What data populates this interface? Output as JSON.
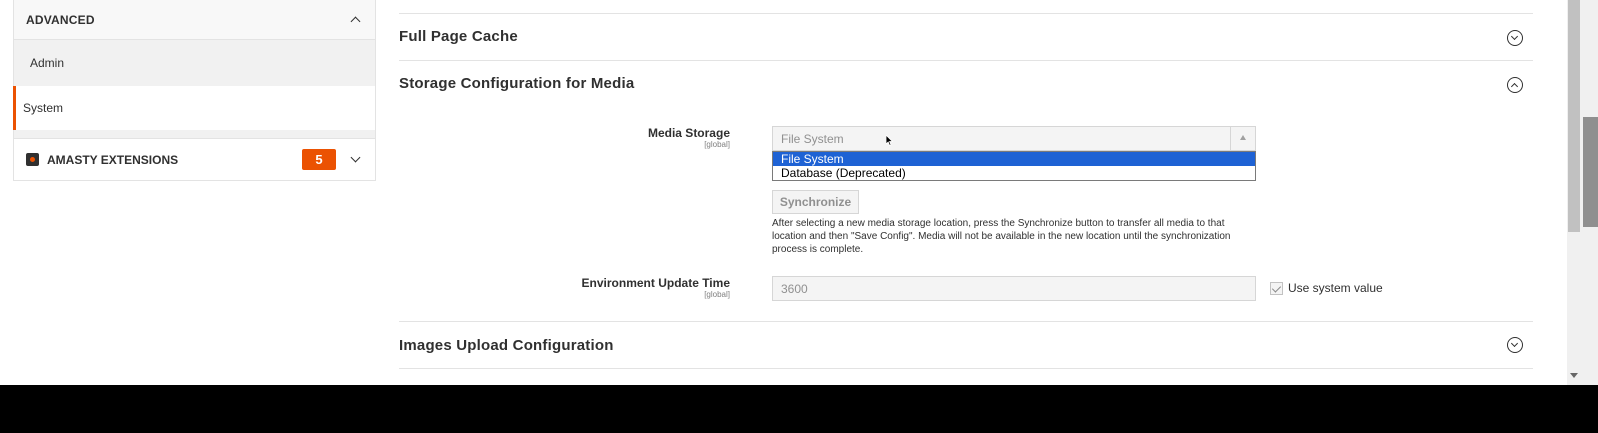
{
  "sidebar": {
    "advanced_title": "ADVANCED",
    "items": [
      {
        "label": "Admin"
      },
      {
        "label": "System"
      }
    ],
    "amasty_title": "AMASTY EXTENSIONS",
    "amasty_badge": "5"
  },
  "sections": {
    "full_page_cache": "Full Page Cache",
    "storage_media": "Storage Configuration for Media",
    "images_upload": "Images Upload Configuration"
  },
  "media_storage": {
    "label": "Media Storage",
    "scope": "[global]",
    "selected": "File System",
    "options": [
      "File System",
      "Database (Deprecated)"
    ],
    "sync_button": "Synchronize",
    "note": "After selecting a new media storage location, press the Synchronize button to transfer all media to that location and then \"Save Config\". Media will not be available in the new location until the synchronization process is complete."
  },
  "env_update": {
    "label": "Environment Update Time",
    "scope": "[global]",
    "value": "3600",
    "use_system_label": "Use system value"
  },
  "colors": {
    "accent": "#eb5202",
    "selection": "#1e62d4"
  }
}
